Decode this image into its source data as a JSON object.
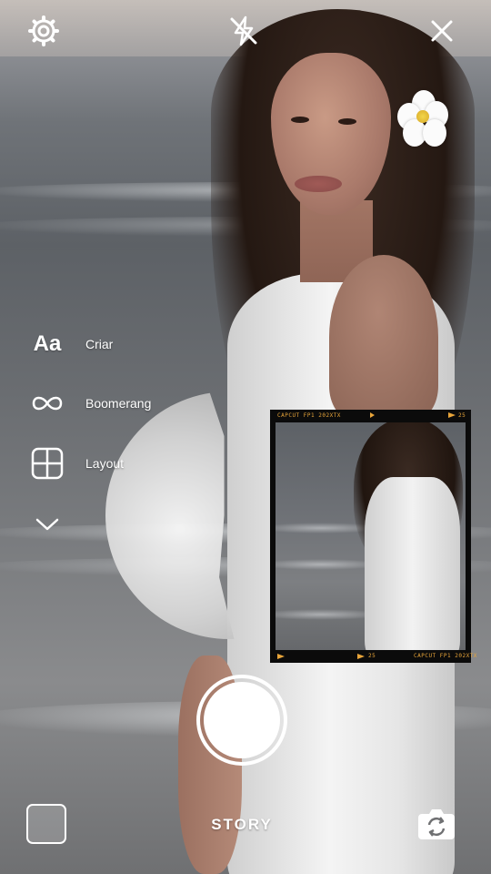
{
  "top_bar": {
    "settings_icon": "gear-icon",
    "flash_icon": "flash-off-icon",
    "close_icon": "close-icon"
  },
  "side_menu": {
    "items": [
      {
        "icon": "Aa",
        "label": "Criar"
      },
      {
        "icon": "infinity-icon",
        "label": "Boomerang"
      },
      {
        "icon": "layout-icon",
        "label": "Layout"
      }
    ],
    "expand_icon": "chevron-down-icon"
  },
  "film_frame": {
    "top_left": "CAPCUT FP1 202XTX",
    "top_right": "25",
    "bottom_mid": "25",
    "bottom_right": "CAPCUT FP1 202XTX",
    "accent_color": "#e8a53a"
  },
  "bottom_bar": {
    "gallery_icon": "gallery-thumbnail",
    "shutter_icon": "shutter-button",
    "mode_label": "STORY",
    "flip_icon": "flip-camera-icon"
  }
}
